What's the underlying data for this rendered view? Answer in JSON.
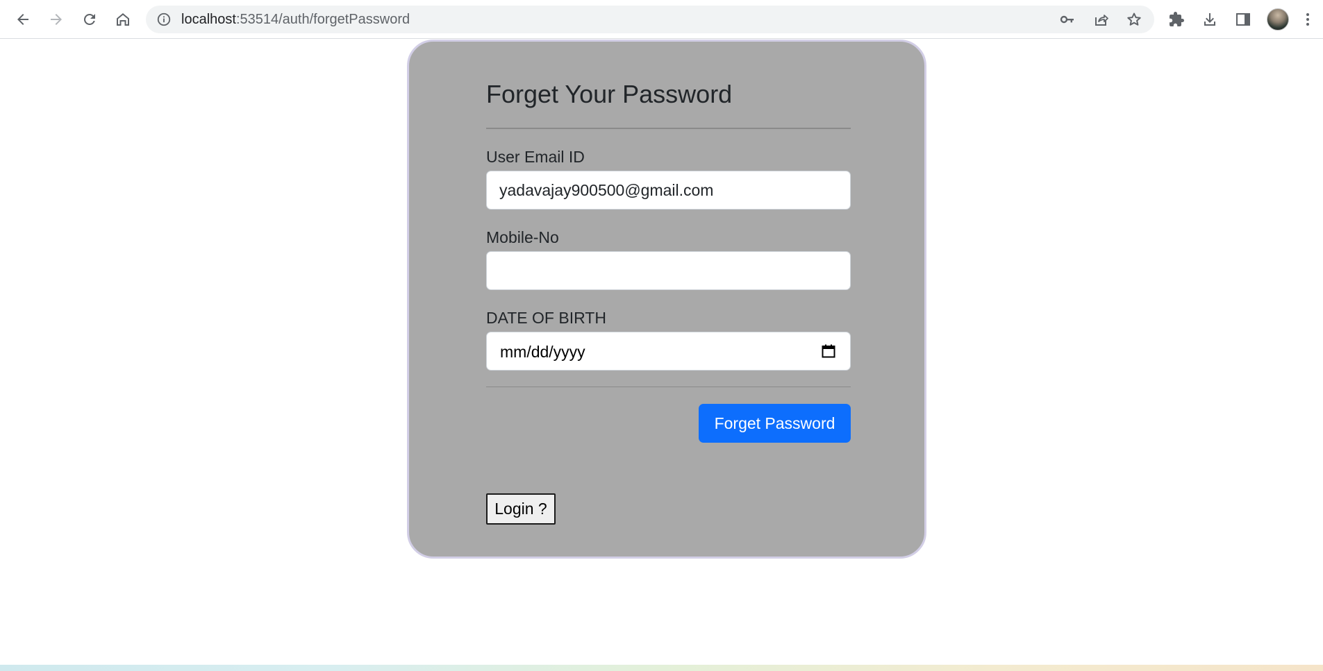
{
  "browser": {
    "url_host": "localhost",
    "url_rest": ":53514/auth/forgetPassword",
    "icons": {
      "back": "back-arrow-icon",
      "forward": "forward-arrow-icon",
      "reload": "reload-icon",
      "home": "home-icon",
      "site_info": "info-icon",
      "password": "key-icon",
      "share": "share-icon",
      "bookmark": "star-icon",
      "extensions": "puzzle-icon",
      "downloads": "download-icon",
      "side_panel": "side-panel-icon",
      "menu": "kebab-menu-icon"
    }
  },
  "form": {
    "title": "Forget Your Password",
    "email_label": "User Email ID",
    "email_value": "yadavajay900500@gmail.com",
    "mobile_label": "Mobile-No",
    "mobile_value": "",
    "dob_label": "DATE OF BIRTH",
    "dob_placeholder": "mm/dd/yyyy",
    "submit_label": "Forget Password",
    "login_label": "Login ?"
  },
  "colors": {
    "card_bg": "#a9a9a9",
    "card_border": "#d2cee6",
    "primary": "#0d6efd"
  }
}
